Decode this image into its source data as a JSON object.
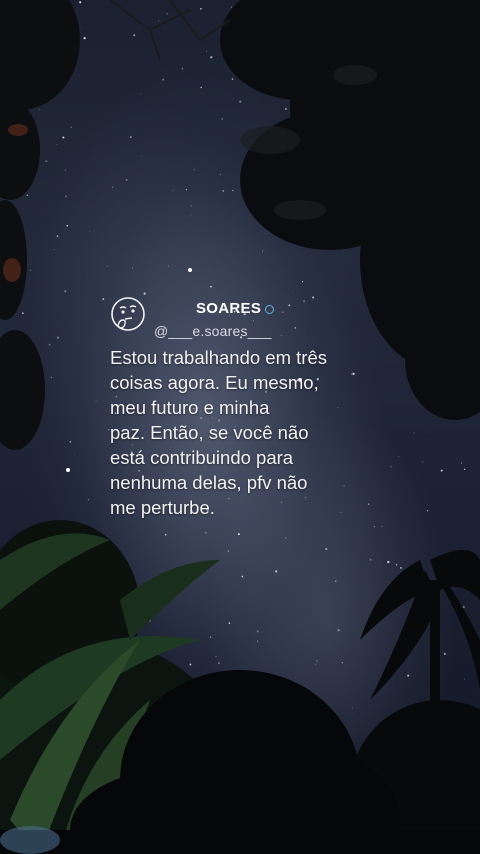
{
  "tweet": {
    "display_name": "SOARES",
    "handle": "@___e.soares___",
    "text": "Estou trabalhando em três\ncoisas agora. Eu mesmo,\nmeu futuro e minha\npaz. Então, se você não\nestá contribuindo para\nnenhuma delas, pfv não\nme perturbe.",
    "avatar_icon": "thinking-face-icon",
    "verified_icon": "verified-badge-icon"
  },
  "colors": {
    "sky": "#1c2233",
    "text": "#f2f2f2",
    "verified": "#5fb6e6"
  }
}
